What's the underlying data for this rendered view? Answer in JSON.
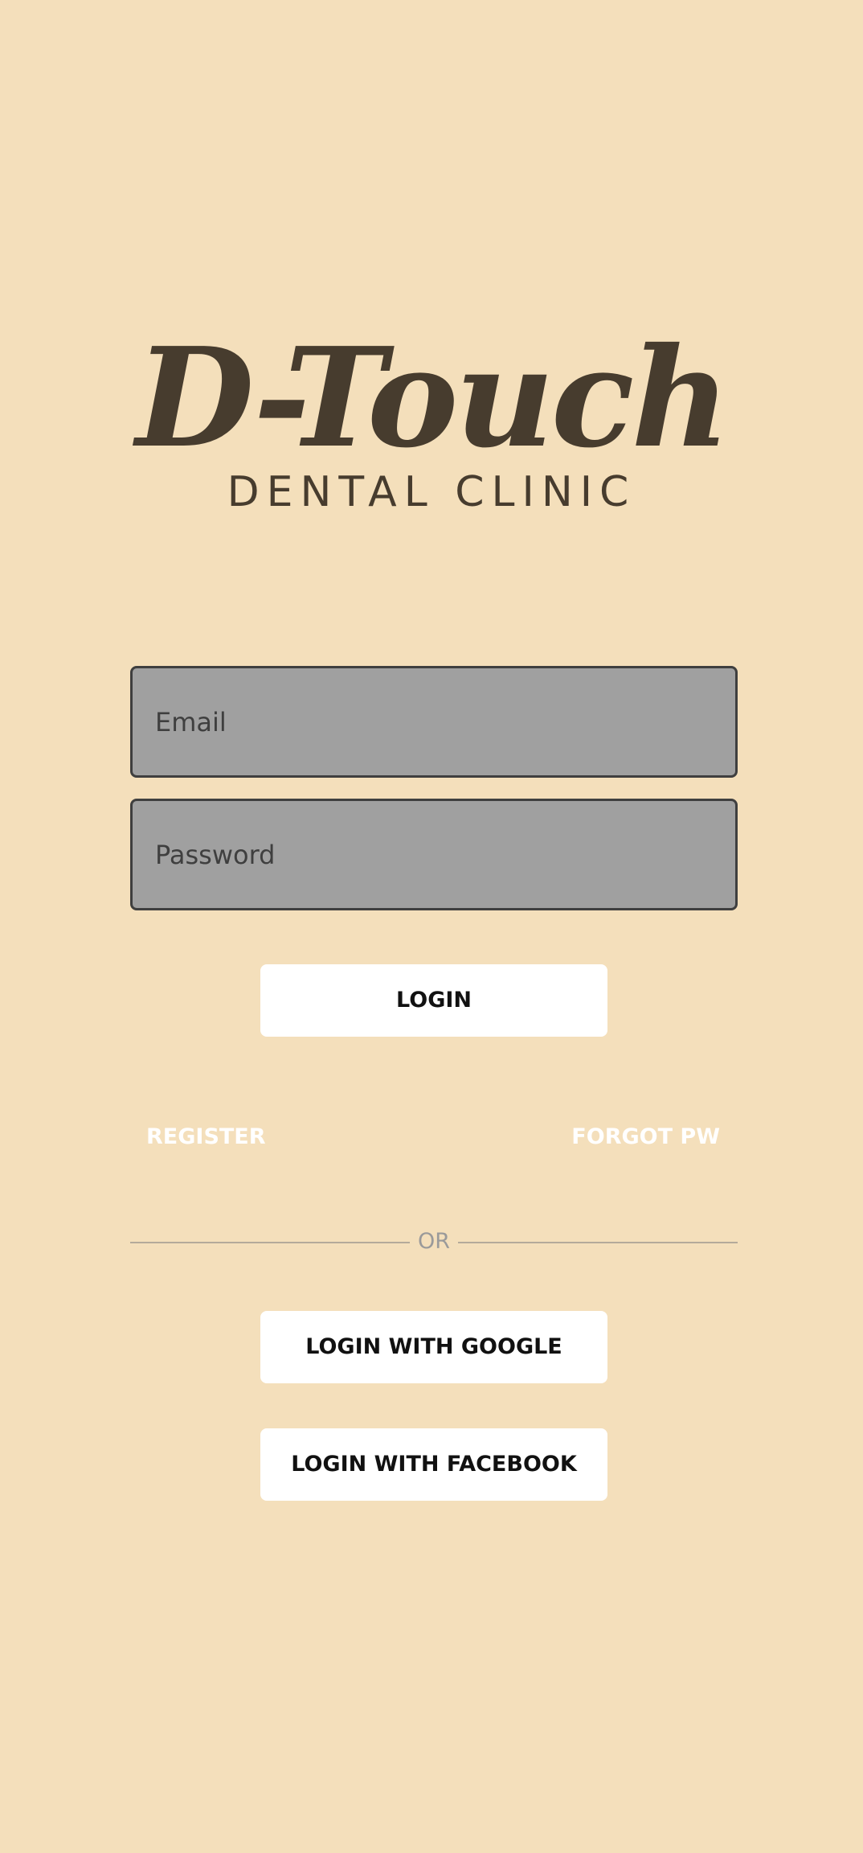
{
  "logo": {
    "title": "D-Touch",
    "subtitle": "DENTAL CLINIC"
  },
  "form": {
    "email_placeholder": "Email",
    "password_placeholder": "Password",
    "login_label": "LOGIN"
  },
  "links": {
    "register": "REGISTER",
    "forgot": "FORGOT PW"
  },
  "divider": {
    "text": "OR"
  },
  "social": {
    "google_label": "LOGIN WITH GOOGLE",
    "facebook_label": "LOGIN WITH FACEBOOK"
  },
  "colors": {
    "background": "#f4dfbb",
    "logo": "#473c2e",
    "field": "#a0a0a0",
    "button": "#ffffff",
    "link": "#ffffff"
  }
}
